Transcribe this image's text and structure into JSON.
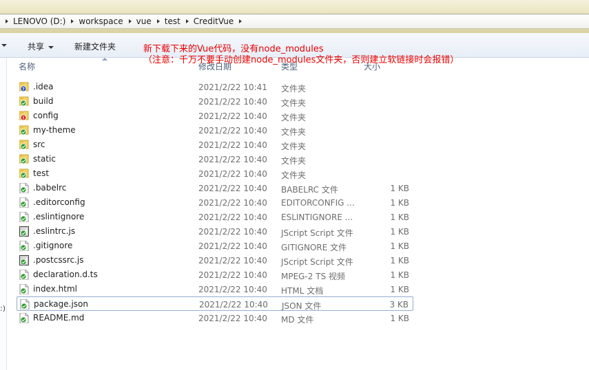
{
  "breadcrumb": [
    "LENOVO (D:)",
    "workspace",
    "vue",
    "test",
    "CreditVue"
  ],
  "toolbar": {
    "share_label": "共享",
    "new_folder_label": "新建文件夹"
  },
  "columns": {
    "name": "名称",
    "date": "修改日期",
    "type": "类型",
    "size": "大小"
  },
  "note": {
    "line1": "新下载下来的Vue代码，没有node_modules",
    "line2": "（注意：千万不要手动创建node_modules文件夹，否则建立软链接时会报错）",
    "color": "#e80000"
  },
  "left_strip_text": ":)",
  "files": [
    {
      "name": ".idea",
      "date": "2021/2/22 10:41",
      "type": "文件夹",
      "size": "",
      "icon": "folder-unknown-icon"
    },
    {
      "name": "build",
      "date": "2021/2/22 10:40",
      "type": "文件夹",
      "size": "",
      "icon": "folder-synced-icon"
    },
    {
      "name": "config",
      "date": "2021/2/22 10:40",
      "type": "文件夹",
      "size": "",
      "icon": "folder-conflict-icon"
    },
    {
      "name": "my-theme",
      "date": "2021/2/22 10:40",
      "type": "文件夹",
      "size": "",
      "icon": "folder-synced-icon"
    },
    {
      "name": "src",
      "date": "2021/2/22 10:40",
      "type": "文件夹",
      "size": "",
      "icon": "folder-synced-icon"
    },
    {
      "name": "static",
      "date": "2021/2/22 10:40",
      "type": "文件夹",
      "size": "",
      "icon": "folder-synced-icon"
    },
    {
      "name": "test",
      "date": "2021/2/22 10:40",
      "type": "文件夹",
      "size": "",
      "icon": "folder-synced-icon"
    },
    {
      "name": ".babelrc",
      "date": "2021/2/22 10:40",
      "type": "BABELRC 文件",
      "size": "1 KB",
      "icon": "file-synced-icon"
    },
    {
      "name": ".editorconfig",
      "date": "2021/2/22 10:40",
      "type": "EDITORCONFIG ...",
      "size": "1 KB",
      "icon": "file-synced-icon"
    },
    {
      "name": ".eslintignore",
      "date": "2021/2/22 10:40",
      "type": "ESLINTIGNORE ...",
      "size": "1 KB",
      "icon": "file-synced-icon"
    },
    {
      "name": ".eslintrc.js",
      "date": "2021/2/22 10:40",
      "type": "JScript Script 文件",
      "size": "1 KB",
      "icon": "script-synced-icon"
    },
    {
      "name": ".gitignore",
      "date": "2021/2/22 10:40",
      "type": "GITIGNORE 文件",
      "size": "1 KB",
      "icon": "file-synced-icon"
    },
    {
      "name": ".postcssrc.js",
      "date": "2021/2/22 10:40",
      "type": "JScript Script 文件",
      "size": "1 KB",
      "icon": "script-synced-icon"
    },
    {
      "name": "declaration.d.ts",
      "date": "2021/2/22 10:40",
      "type": "MPEG-2 TS 视频",
      "size": "1 KB",
      "icon": "file-synced-icon"
    },
    {
      "name": "index.html",
      "date": "2021/2/22 10:40",
      "type": "HTML 文档",
      "size": "1 KB",
      "icon": "file-synced-icon"
    },
    {
      "name": "package.json",
      "date": "2021/2/22 10:40",
      "type": "JSON 文件",
      "size": "3 KB",
      "icon": "file-synced-icon",
      "selected": true
    },
    {
      "name": "README.md",
      "date": "2021/2/22 10:40",
      "type": "MD 文件",
      "size": "1 KB",
      "icon": "file-synced-icon"
    }
  ]
}
